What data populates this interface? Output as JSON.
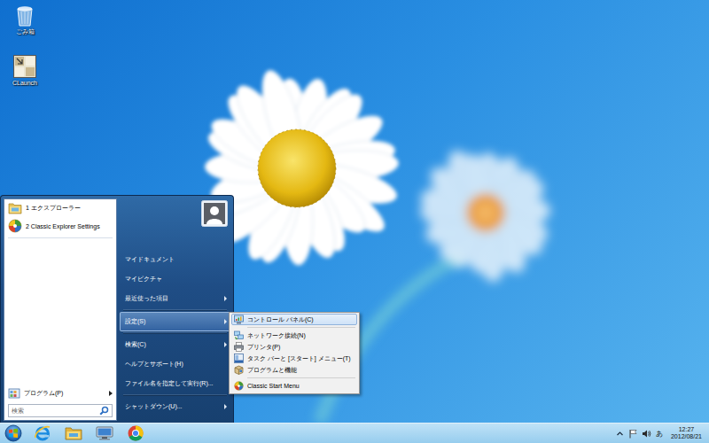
{
  "desktop": {
    "icons": [
      {
        "label": "ごみ箱"
      },
      {
        "label": "CLaunch"
      }
    ]
  },
  "start_menu": {
    "pinned": [
      {
        "label": "1 エクスプローラー"
      },
      {
        "label": "2 Classic Explorer Settings"
      }
    ],
    "programs": {
      "label": "プログラム(P)",
      "submenu": true
    },
    "search": {
      "placeholder": "検索"
    },
    "groups": [
      [
        {
          "label": "マイドキュメント",
          "submenu": false,
          "selected": false
        },
        {
          "label": "マイピクチャ",
          "submenu": false,
          "selected": false
        },
        {
          "label": "最近使った項目",
          "submenu": true,
          "selected": false
        }
      ],
      [
        {
          "label": "設定(S)",
          "submenu": true,
          "selected": true
        }
      ],
      [
        {
          "label": "検索(C)",
          "submenu": true,
          "selected": false
        },
        {
          "label": "ヘルプとサポート(H)",
          "submenu": false,
          "selected": false
        },
        {
          "label": "ファイル名を指定して実行(R)...",
          "submenu": false,
          "selected": false
        }
      ],
      [
        {
          "label": "シャットダウン(U)...",
          "submenu": true,
          "selected": false
        }
      ]
    ]
  },
  "submenu": {
    "groups": [
      [
        {
          "label": "コントロール パネル(C)",
          "selected": true
        }
      ],
      [
        {
          "label": "ネットワーク接続(N)",
          "selected": false
        },
        {
          "label": "プリンタ(P)",
          "selected": false
        },
        {
          "label": "タスク バーと [スタート] メニュー(T)",
          "selected": false
        },
        {
          "label": "プログラムと機能",
          "selected": false
        }
      ],
      [
        {
          "label": "Classic Start Menu",
          "selected": false
        }
      ]
    ]
  },
  "taskbar": {
    "tray": {
      "ime": "あ",
      "time": "12:27",
      "date": "2012/08/21"
    }
  }
}
